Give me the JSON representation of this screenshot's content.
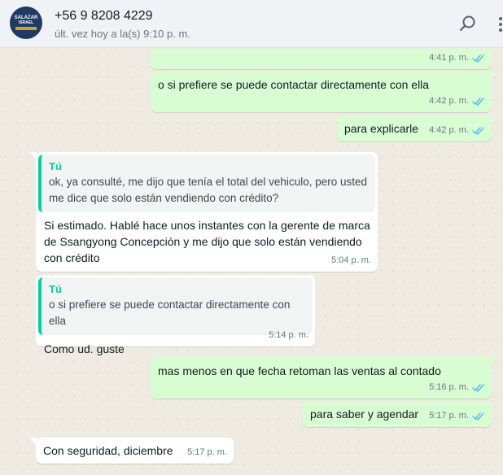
{
  "header": {
    "contact_name": "+56 9 8208 4229",
    "last_seen": "últ. vez hoy a la(s) 9:10 p. m.",
    "avatar": {
      "line1": "SALAZAR",
      "line2": "ISRAEL"
    }
  },
  "messages": [
    {
      "dir": "out",
      "text": "",
      "time": "4:41 p. m.",
      "ticks": "read"
    },
    {
      "dir": "out",
      "text": "o si prefiere se puede contactar directamente con ella",
      "time": "4:42 p. m.",
      "ticks": "read"
    },
    {
      "dir": "out",
      "text": "para explicarle",
      "time": "4:42 p. m.",
      "ticks": "read"
    },
    {
      "dir": "in",
      "quote_author": "Tú",
      "quote_text": "ok, ya consulté, me dijo que tenía el total del vehiculo, pero usted me dice que solo están vendiendo con crédito?",
      "text": "Si estimado. Hablé hace unos instantes con la gerente de marca de Ssangyong Concepción y me dijo que solo están vendiendo con crédito",
      "time": "5:04 p. m."
    },
    {
      "dir": "in",
      "quote_author": "Tú",
      "quote_text": "o si prefiere se puede contactar directamente con ella",
      "text": "Como ud. guste",
      "time": "5:14 p. m."
    },
    {
      "dir": "out",
      "text": "mas menos en que fecha retoman las ventas al contado",
      "time": "5:16 p. m.",
      "ticks": "read"
    },
    {
      "dir": "out",
      "text": "para saber y agendar",
      "time": "5:17 p. m.",
      "ticks": "read"
    },
    {
      "dir": "in",
      "text": "Con seguridad, diciembre",
      "time": "5:17 p. m."
    }
  ],
  "colors": {
    "outgoing_bubble": "#d9fdd3",
    "incoming_bubble": "#ffffff",
    "quote_accent": "#06cf9c",
    "read_tick": "#53bdeb",
    "chat_background": "#efeae2"
  },
  "icons": [
    "search-icon",
    "menu-icon",
    "double-check-icon"
  ]
}
